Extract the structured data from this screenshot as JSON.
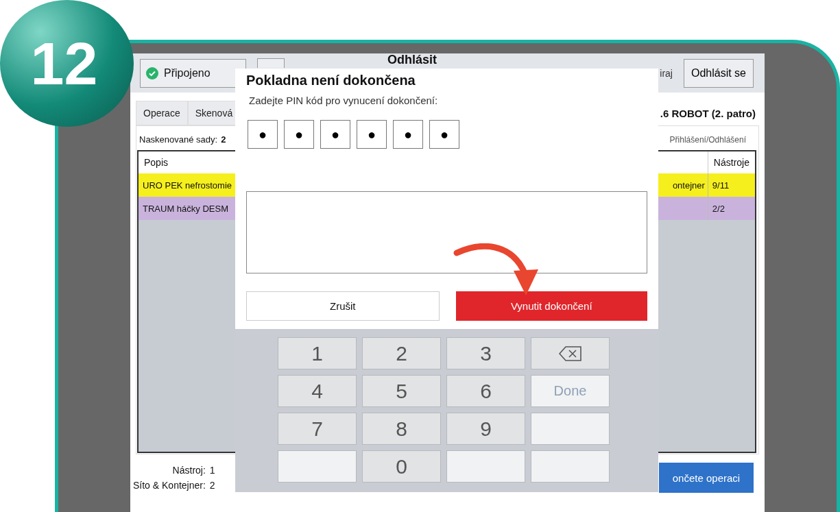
{
  "step_badge": "12",
  "top_bar": {
    "status": "Připojeno",
    "title": "Odhlásit",
    "user_partial": "iraj",
    "logout_button": "Odhlásit se"
  },
  "tabs": [
    {
      "label": "Operace"
    },
    {
      "label": "Skenová"
    }
  ],
  "location": ".6 ROBOT (2. patro)",
  "scanned_sets": {
    "label": "Naskenované sady:",
    "value": "2"
  },
  "login_link": "Přihlášení/Odhlášení",
  "table": {
    "columns": [
      "Popis",
      "",
      "Nástroje"
    ],
    "rows": [
      {
        "cells": [
          "URO PEK nefrostomie",
          "ontejner",
          "9/11"
        ],
        "color": "#f5ef1e"
      },
      {
        "cells": [
          "TRAUM háčky DESM",
          "",
          "2/2"
        ],
        "color": "#c9b3dc"
      }
    ]
  },
  "footer": {
    "tool_label": "Nástroj:",
    "tool_value": "1",
    "sieve_label": "Síto & Kontejner:",
    "sieve_value": "2",
    "finish_button": "ončete operaci"
  },
  "dialog": {
    "title": "Pokladna není dokončena",
    "prompt": "Zadejte PIN kód pro vynucení dokončení:",
    "pin": [
      "●",
      "●",
      "●",
      "●",
      "●",
      "●"
    ],
    "cancel_button": "Zrušit",
    "force_button": "Vynutit dokončení"
  },
  "keypad": [
    {
      "kind": "digit",
      "label": "1"
    },
    {
      "kind": "digit",
      "label": "2"
    },
    {
      "kind": "digit",
      "label": "3"
    },
    {
      "kind": "backspace"
    },
    {
      "kind": "digit",
      "label": "4"
    },
    {
      "kind": "digit",
      "label": "5"
    },
    {
      "kind": "digit",
      "label": "6"
    },
    {
      "kind": "done",
      "label": "Done"
    },
    {
      "kind": "digit",
      "label": "7"
    },
    {
      "kind": "digit",
      "label": "8"
    },
    {
      "kind": "digit",
      "label": "9"
    },
    {
      "kind": "blank"
    },
    {
      "kind": "blank"
    },
    {
      "kind": "digit",
      "label": "0"
    },
    {
      "kind": "blank"
    },
    {
      "kind": "blank"
    }
  ]
}
